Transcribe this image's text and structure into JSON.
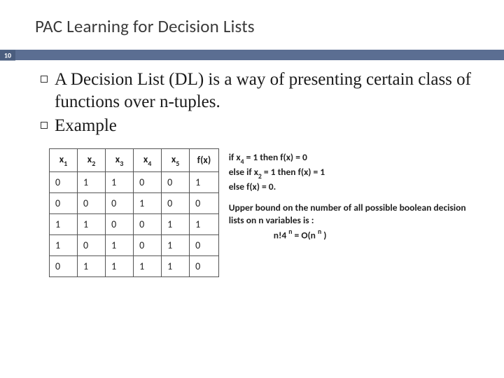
{
  "title": "PAC Learning for Decision Lists",
  "slide_number": "10",
  "bullets": [
    "A Decision List (DL) is a way of presenting certain class of functions over n-tuples.",
    "Example"
  ],
  "table": {
    "headers": [
      {
        "base": "x",
        "sub": "1"
      },
      {
        "base": "x",
        "sub": "2"
      },
      {
        "base": "x",
        "sub": "3"
      },
      {
        "base": "x",
        "sub": "4"
      },
      {
        "base": "x",
        "sub": "5"
      },
      {
        "base": "f(x)",
        "sub": ""
      }
    ],
    "rows": [
      [
        "0",
        "1",
        "1",
        "0",
        "0",
        "1"
      ],
      [
        "0",
        "0",
        "0",
        "1",
        "0",
        "0"
      ],
      [
        "1",
        "1",
        "0",
        "0",
        "1",
        "1"
      ],
      [
        "1",
        "0",
        "1",
        "0",
        "1",
        "0"
      ],
      [
        "0",
        "1",
        "1",
        "1",
        "1",
        "0"
      ]
    ]
  },
  "rules": {
    "l1_pre": "if x",
    "l1_sub": "4",
    "l1_post": " = 1 then f(x) = 0",
    "l2_pre": "else if x",
    "l2_sub": "2",
    "l2_post": " = 1 then f(x) = 1",
    "l3": "else f(x) = 0."
  },
  "bound": {
    "intro": "Upper bound on the number of all possible boolean decision lists on n variables is :",
    "f1": "n!4 ",
    "sup1": "n",
    "f2": " = O(n ",
    "sup2": "n",
    "f3": " )"
  }
}
